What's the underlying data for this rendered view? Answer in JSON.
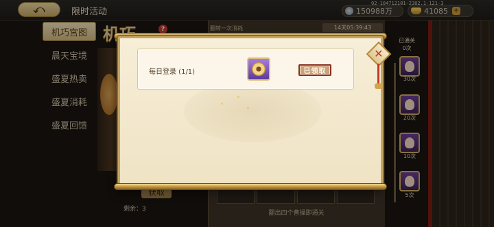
{
  "header": {
    "back_glyph": "⤺",
    "title": "限时活动",
    "server_id": "02-104712181-2302.1-121-3",
    "silver": "150988万",
    "gold": "41085",
    "plus": "+"
  },
  "nav": {
    "items": [
      {
        "label": "机巧宫图",
        "active": true
      },
      {
        "label": "晨天宝境",
        "active": false
      },
      {
        "label": "盛夏热卖",
        "active": false
      },
      {
        "label": "盛夏消耗",
        "active": false
      },
      {
        "label": "盛夏回馈",
        "active": false
      }
    ]
  },
  "background": {
    "event_title": "机巧",
    "help": "?",
    "tab_hint": "翻转一次消耗",
    "timer": "14天05:39:43",
    "fetch_label": "获取",
    "remaining": "剩余：3",
    "footer_hint": "翻出四个曹操即通关",
    "cleared_label": "已通关",
    "cleared_count": "0次",
    "milestones": [
      "30次",
      "20次",
      "10次",
      "5次"
    ]
  },
  "modal": {
    "close_glyph": "✕",
    "task_label": "每日登录 (1/1)",
    "claimed_label": "已领取"
  },
  "colors": {
    "accent_gold": "#c6a462",
    "stamp_red": "#8a2f24",
    "close_red": "#c0392b"
  }
}
